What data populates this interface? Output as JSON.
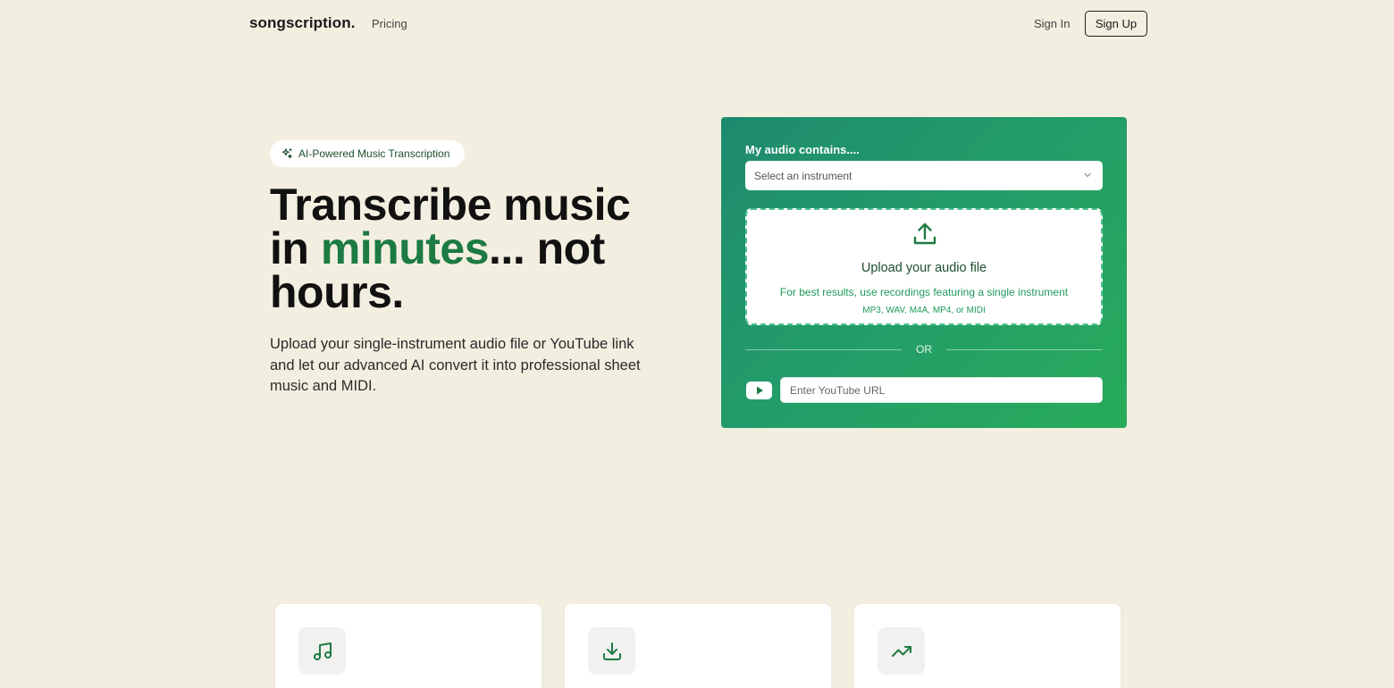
{
  "nav": {
    "logo": "songscription.",
    "pricing": "Pricing",
    "sign_in": "Sign In",
    "sign_up": "Sign Up"
  },
  "hero": {
    "badge": "AI-Powered Music Transcription",
    "headline_line1": "Transcribe music",
    "headline_in": "in ",
    "headline_accent": "minutes",
    "headline_after": "... not",
    "headline_line3": "hours.",
    "subtext": "Upload your single-instrument audio file or YouTube link and let our advanced AI convert it into professional sheet music and MIDI."
  },
  "upload_card": {
    "label": "My audio contains....",
    "select_placeholder": "Select an instrument",
    "dropzone_title": "Upload your audio file",
    "dropzone_hint": "For best results, use recordings featuring a single instrument",
    "dropzone_formats": "MP3, WAV, M4A, MP4, or MIDI",
    "or": "OR",
    "youtube_placeholder": "Enter YouTube URL"
  },
  "features": [
    {
      "icon": "music-note-icon"
    },
    {
      "icon": "download-icon"
    },
    {
      "icon": "trending-up-icon"
    }
  ],
  "colors": {
    "background": "#f3efe0",
    "accent_green": "#1c7a42",
    "card_gradient_start": "#1f8a6e",
    "card_gradient_end": "#28ab5a"
  }
}
